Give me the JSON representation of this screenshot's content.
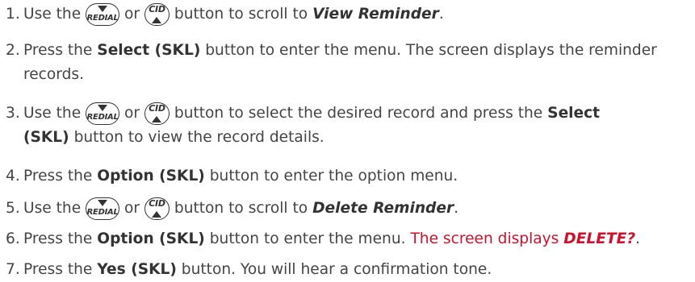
{
  "steps": [
    {
      "num": "1.",
      "a": "Use the",
      "or": "or",
      "b": "button to scroll to",
      "target": "View Reminder",
      "end": "."
    },
    {
      "num": "2.",
      "a": "Press the",
      "bold": "Select (SKL)",
      "b": "button to enter the menu. The screen displays the reminder",
      "c": "records."
    },
    {
      "num": "3.",
      "a": "Use the",
      "or": "or",
      "b": "button to select the desired record and press the",
      "bold1": "Select",
      "bold2": "(SKL)",
      "c": "button to view the record details."
    },
    {
      "num": "4.",
      "a": "Press the",
      "bold": "Option (SKL)",
      "b": "button to enter the option menu."
    },
    {
      "num": "5.",
      "a": "Use the",
      "or": "or",
      "b": "button to scroll to",
      "target": "Delete Reminder",
      "end": "."
    },
    {
      "num": "6.",
      "a": "Press the",
      "bold": "Option (SKL)",
      "b": "button to enter the menu.",
      "red": "The screen displays",
      "redbold": "DELETE?",
      "end": "."
    },
    {
      "num": "7.",
      "a": "Press the",
      "bold": "Yes (SKL)",
      "b": "button. You will hear a confirmation tone."
    }
  ],
  "buttons": {
    "redial_label": "REDIAL",
    "cid_label": "CID"
  },
  "colors": {
    "text": "#444444",
    "highlight": "#d0112b"
  },
  "icons": [
    "redial-down-button-icon",
    "cid-up-button-icon"
  ]
}
